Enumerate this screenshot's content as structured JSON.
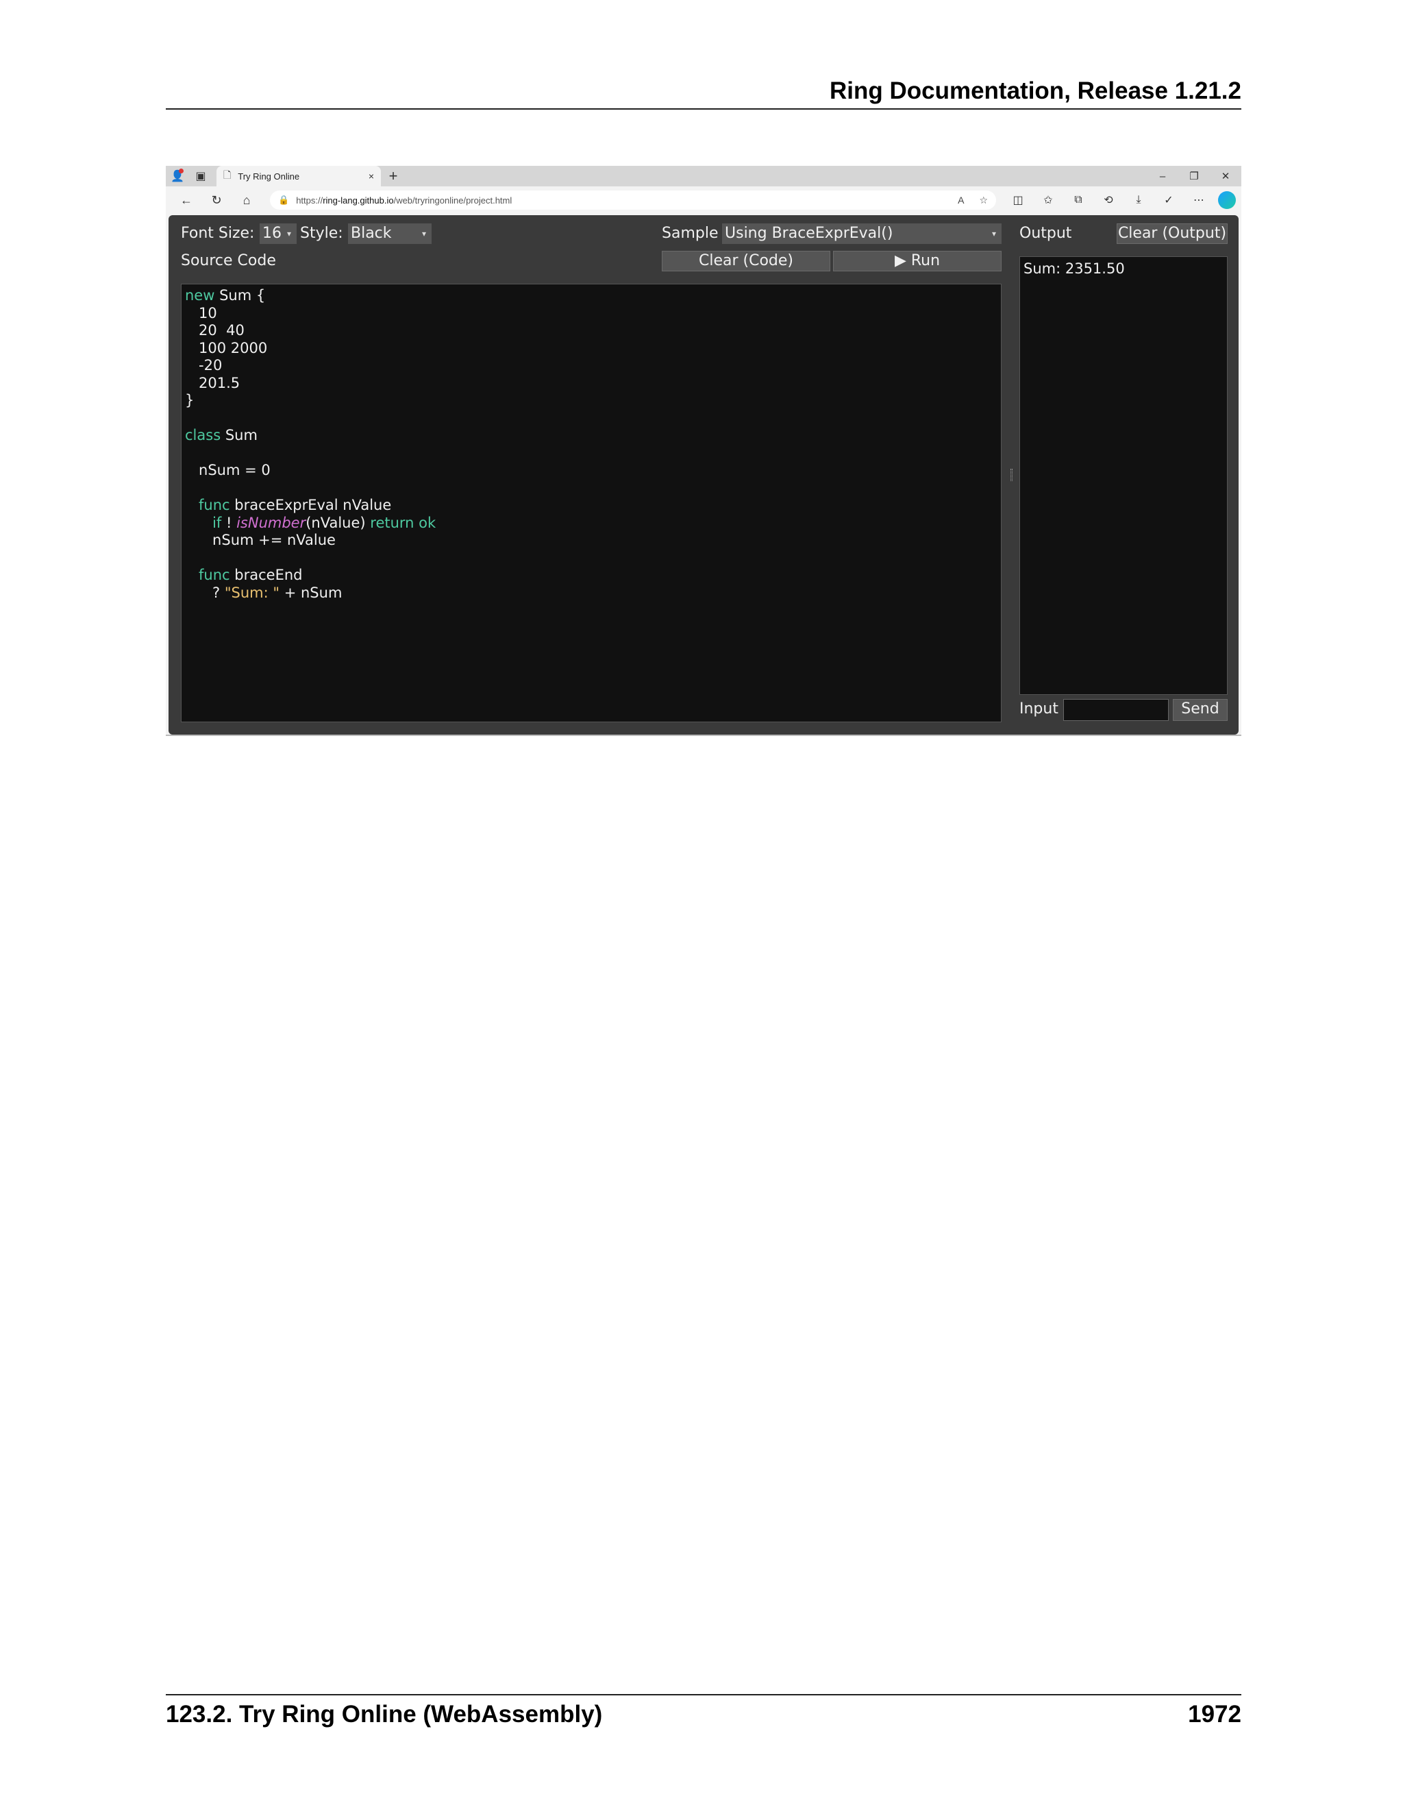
{
  "document": {
    "header": "Ring Documentation, Release 1.21.2",
    "footer_section": "123.2.  Try Ring Online (WebAssembly)",
    "footer_page": "1972"
  },
  "browser": {
    "tab_title": "Try Ring Online",
    "tab_close": "×",
    "new_tab": "+",
    "url_prefix": "https://",
    "url_host": "ring-lang.github.io",
    "url_path": "/web/tryringonline/project.html",
    "win_minimize": "–",
    "win_restore": "❐",
    "win_close": "✕",
    "icons": {
      "back": "←",
      "reload": "↻",
      "home": "⌂",
      "lock": "🔒",
      "read_aloud": "A",
      "favorite": "☆",
      "split": "◫",
      "favorites": "✩",
      "collections": "⧉",
      "history": "⟲",
      "downloads": "⤓",
      "shield": "✓",
      "more": "⋯",
      "tab_actions": "▣",
      "profile": "👤",
      "page": "🗋"
    }
  },
  "app": {
    "font_size_label": "Font Size:",
    "font_size_value": "16",
    "style_label": "Style:",
    "style_value": "Black",
    "sample_label": "Sample",
    "sample_value": "Using BraceExprEval()",
    "output_label": "Output",
    "clear_output_label": "Clear (Output)",
    "source_code_label": "Source Code",
    "clear_code_label": "Clear (Code)",
    "run_label": "▶ Run",
    "dropdown_arrow": "▾",
    "output_text": "Sum: 2351.50",
    "input_label": "Input",
    "send_label": "Send",
    "input_value": ""
  },
  "code": {
    "l1_kw": "new",
    "l1_rest": " Sum {",
    "l2": "   10",
    "l3": "   20  40",
    "l4": "   100 2000",
    "l5": "   -20",
    "l6": "   201.5",
    "l7": "}",
    "l9_kw": "class",
    "l9_rest": " Sum",
    "l11": "   nSum = 0",
    "l13_indent": "   ",
    "l13_kw": "func",
    "l13_rest": " braceExprEval nValue",
    "l14_indent": "      ",
    "l14_kw_if": "if",
    "l14_bang": " ! ",
    "l14_fn": "isNumber",
    "l14_args": "(nValue) ",
    "l14_kw_ret": "return ok",
    "l15": "      nSum += nValue",
    "l17_indent": "   ",
    "l17_kw": "func",
    "l17_rest": " braceEnd",
    "l18_indent": "      ? ",
    "l18_str": "\"Sum: \"",
    "l18_rest": " + nSum"
  },
  "colors": {
    "keyword": "#4ec9a0",
    "function": "#d070d0",
    "string": "#e8c070",
    "editor_bg": "#111111",
    "panel_bg": "#3a3a3a"
  }
}
